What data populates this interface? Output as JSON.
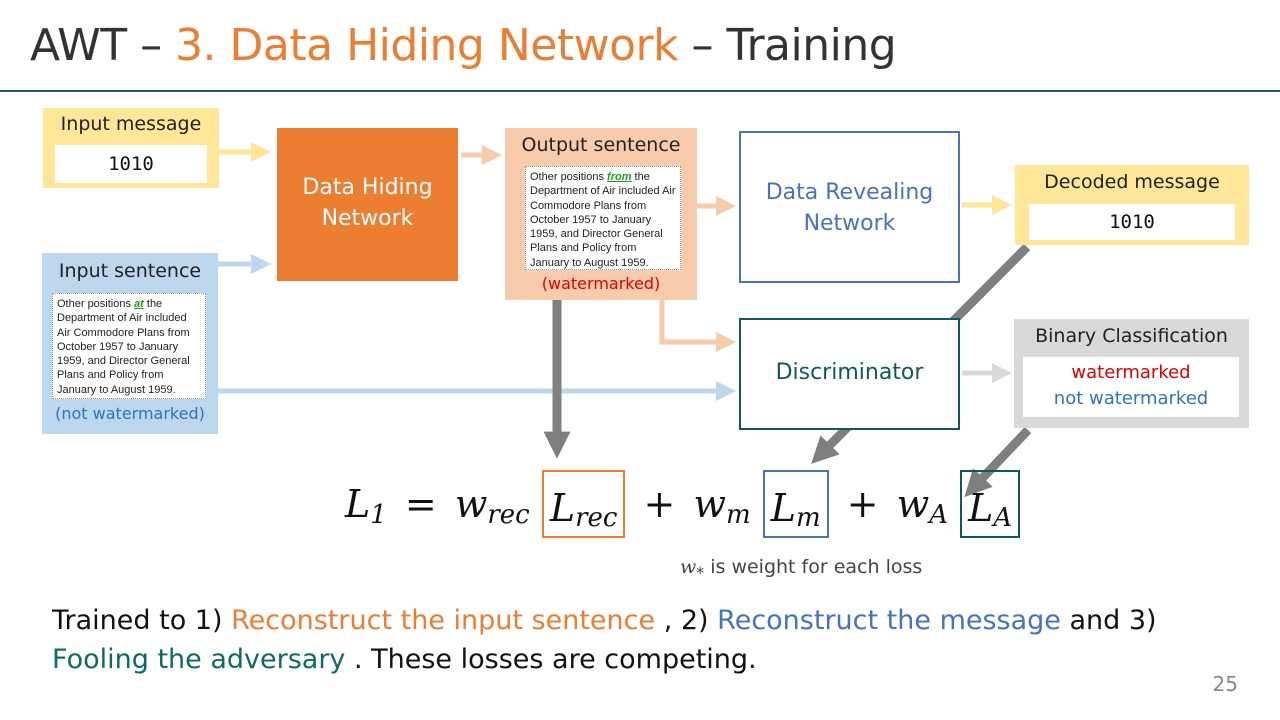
{
  "title": {
    "prefix": "AWT – ",
    "accent": "3. Data Hiding Network",
    "suffix": " – Training"
  },
  "diagram": {
    "input_message": {
      "label": "Input message",
      "value": "1010"
    },
    "input_sentence": {
      "label": "Input sentence",
      "text_before": "Other positions ",
      "highlight": "at",
      "text_after": " the Department of Air included Air Commodore Plans from October 1957 to January 1959, and Director General Plans and Policy from January to August 1959.",
      "status": "(not watermarked)"
    },
    "data_hiding_network": {
      "label": "Data Hiding Network"
    },
    "output_sentence": {
      "label": "Output sentence",
      "text_before": "Other positions ",
      "highlight": "from",
      "text_after": " the Department of Air included Air Commodore Plans from October 1957 to January 1959, and Director General Plans and Policy from January to August 1959.",
      "status": "(watermarked)"
    },
    "data_revealing_network": {
      "label": "Data Revealing Network"
    },
    "discriminator": {
      "label": "Discriminator"
    },
    "decoded_message": {
      "label": "Decoded message",
      "value": "1010"
    },
    "binary_classification": {
      "label": "Binary Classification",
      "option_1": "watermarked",
      "option_2": "not watermarked"
    }
  },
  "equation": {
    "lhs": "L",
    "lhs_sub": "1",
    "w_rec": "w",
    "w_rec_sub": "rec",
    "l_rec": "L",
    "l_rec_sub": "rec",
    "w_m": "w",
    "w_m_sub": "m",
    "l_m": "L",
    "l_m_sub": "m",
    "w_a": "w",
    "w_a_sub": "A",
    "l_a": "L",
    "l_a_sub": "A",
    "equals": "=",
    "plus": "+",
    "note_symbol": "w",
    "note_sub": "*",
    "note_text": " is weight for each loss"
  },
  "summary": {
    "part1": "Trained to 1) ",
    "goal1": "Reconstruct the input sentence",
    "part2": " , 2) ",
    "goal2": "Reconstruct the message",
    "part3": " and 3) ",
    "goal3": "Fooling the adversary",
    "part4": " .  These losses are competing."
  },
  "page_number": "25",
  "colors": {
    "orange": "#ed7d31",
    "blue": "#4472c4",
    "teal": "#0e5a5a",
    "yellow": "#ffe699",
    "peach": "#f8cbad",
    "light_blue": "#bdd7ee",
    "grey": "#d9d9d9",
    "red": "#e00000"
  }
}
